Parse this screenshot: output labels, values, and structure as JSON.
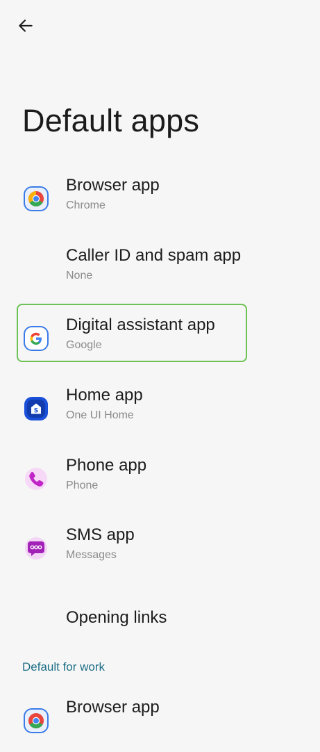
{
  "header": {
    "title": "Default apps"
  },
  "items": [
    {
      "label": "Browser app",
      "value": "Chrome",
      "icon": "chrome-icon"
    },
    {
      "label": "Caller ID and spam app",
      "value": "None",
      "icon": ""
    },
    {
      "label": "Digital assistant app",
      "value": "Google",
      "icon": "google-icon"
    },
    {
      "label": "Home app",
      "value": "One UI Home",
      "icon": "one-ui-home-icon"
    },
    {
      "label": "Phone app",
      "value": "Phone",
      "icon": "phone-icon"
    },
    {
      "label": "SMS app",
      "value": "Messages",
      "icon": "messages-icon"
    },
    {
      "label": "Opening links",
      "value": "",
      "icon": ""
    }
  ],
  "work_section": {
    "header": "Default for work",
    "items": [
      {
        "label": "Browser app",
        "icon": "chrome-icon"
      }
    ]
  },
  "colors": {
    "background": "#f6f6f6",
    "highlight_border": "#6cc255",
    "section_header": "#1d6f87"
  }
}
